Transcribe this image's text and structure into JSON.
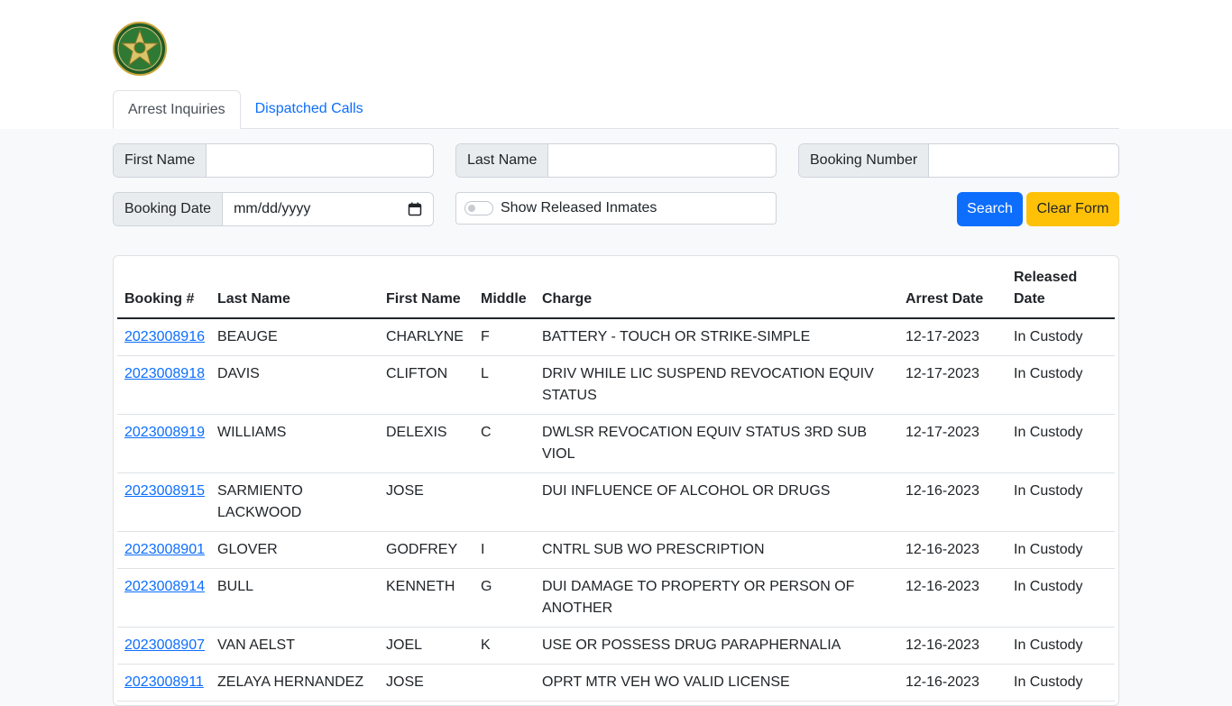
{
  "tabs": [
    {
      "label": "Arrest Inquiries",
      "active": true
    },
    {
      "label": "Dispatched Calls",
      "active": false
    }
  ],
  "form": {
    "first_name_label": "First Name",
    "first_name_value": "",
    "last_name_label": "Last Name",
    "last_name_value": "",
    "booking_number_label": "Booking Number",
    "booking_number_value": "",
    "booking_date_label": "Booking Date",
    "booking_date_placeholder": "mm/dd/yyyy",
    "show_released_label": "Show Released Inmates",
    "show_released_checked": false,
    "search_label": "Search",
    "clear_label": "Clear Form"
  },
  "table": {
    "headers": [
      "Booking #",
      "Last Name",
      "First Name",
      "Middle",
      "Charge",
      "Arrest Date",
      "Released Date"
    ],
    "rows": [
      {
        "booking": "2023008916",
        "last": "BEAUGE",
        "first": "CHARLYNE",
        "middle": "F",
        "charge": "BATTERY - TOUCH OR STRIKE-SIMPLE",
        "arrest_date": "12-17-2023",
        "released": "In Custody"
      },
      {
        "booking": "2023008918",
        "last": "DAVIS",
        "first": "CLIFTON",
        "middle": "L",
        "charge": "DRIV WHILE LIC SUSPEND REVOCATION EQUIV STATUS",
        "arrest_date": "12-17-2023",
        "released": "In Custody"
      },
      {
        "booking": "2023008919",
        "last": "WILLIAMS",
        "first": "DELEXIS",
        "middle": "C",
        "charge": "DWLSR REVOCATION EQUIV STATUS 3RD SUB VIOL",
        "arrest_date": "12-17-2023",
        "released": "In Custody"
      },
      {
        "booking": "2023008915",
        "last": "SARMIENTO LACKWOOD",
        "first": "JOSE",
        "middle": "",
        "charge": "DUI INFLUENCE OF ALCOHOL OR DRUGS",
        "arrest_date": "12-16-2023",
        "released": "In Custody"
      },
      {
        "booking": "2023008901",
        "last": "GLOVER",
        "first": "GODFREY",
        "middle": "I",
        "charge": "CNTRL SUB WO PRESCRIPTION",
        "arrest_date": "12-16-2023",
        "released": "In Custody"
      },
      {
        "booking": "2023008914",
        "last": "BULL",
        "first": "KENNETH",
        "middle": "G",
        "charge": "DUI DAMAGE TO PROPERTY OR PERSON OF ANOTHER",
        "arrest_date": "12-16-2023",
        "released": "In Custody"
      },
      {
        "booking": "2023008907",
        "last": "VAN AELST",
        "first": "JOEL",
        "middle": "K",
        "charge": "USE OR POSSESS DRUG PARAPHERNALIA",
        "arrest_date": "12-16-2023",
        "released": "In Custody"
      },
      {
        "booking": "2023008911",
        "last": "ZELAYA HERNANDEZ",
        "first": "JOSE",
        "middle": "",
        "charge": "OPRT MTR VEH WO VALID LICENSE",
        "arrest_date": "12-16-2023",
        "released": "In Custody"
      }
    ]
  },
  "icons": {
    "logo": "sheriff-star-badge-icon",
    "calendar": "calendar-icon"
  },
  "colors": {
    "primary": "#0d6efd",
    "warning": "#ffc107",
    "badge_green": "#2e6b2f",
    "badge_gold": "#c9a53a"
  }
}
